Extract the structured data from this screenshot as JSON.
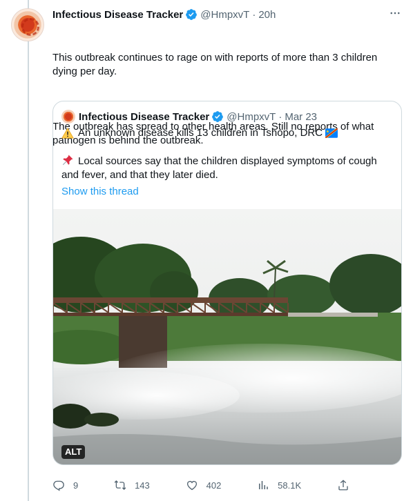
{
  "author": {
    "name": "Infectious Disease Tracker",
    "handle": "@HmpxvT",
    "separator": "·",
    "time": "20h"
  },
  "tweet": {
    "paragraph1": "This outbreak continues to rage on with reports of more than 3 children dying per day.",
    "paragraph2": "The outbreak has spread to other health areas. Still no reports of what pathogen is behind the outbreak."
  },
  "quote": {
    "name": "Infectious Disease Tracker",
    "handle": "@HmpxvT",
    "separator": "·",
    "date": "Mar 23",
    "line1": "An unknown disease kills 13 children in Tshopo, DRC",
    "line2": "Local sources say that the children displayed symptoms of cough and fever, and that they later died.",
    "show_thread": "Show this thread",
    "image_alt_badge": "ALT"
  },
  "actions": {
    "reply_count": "9",
    "retweet_count": "143",
    "like_count": "402",
    "views_count": "58.1K"
  },
  "icons": {
    "more": "more-icon",
    "verified": "verified-badge-icon",
    "warning": "warning-emoji-icon",
    "pin": "pushpin-emoji-icon",
    "flag": "drc-flag-emoji-icon",
    "reply": "reply-icon",
    "retweet": "retweet-icon",
    "like": "like-icon",
    "views": "views-icon",
    "share": "share-icon"
  },
  "colors": {
    "text": "#0f1419",
    "muted": "#536471",
    "link": "#1d9bf0",
    "border": "#cfd9de",
    "verified": "#1d9bf0"
  }
}
